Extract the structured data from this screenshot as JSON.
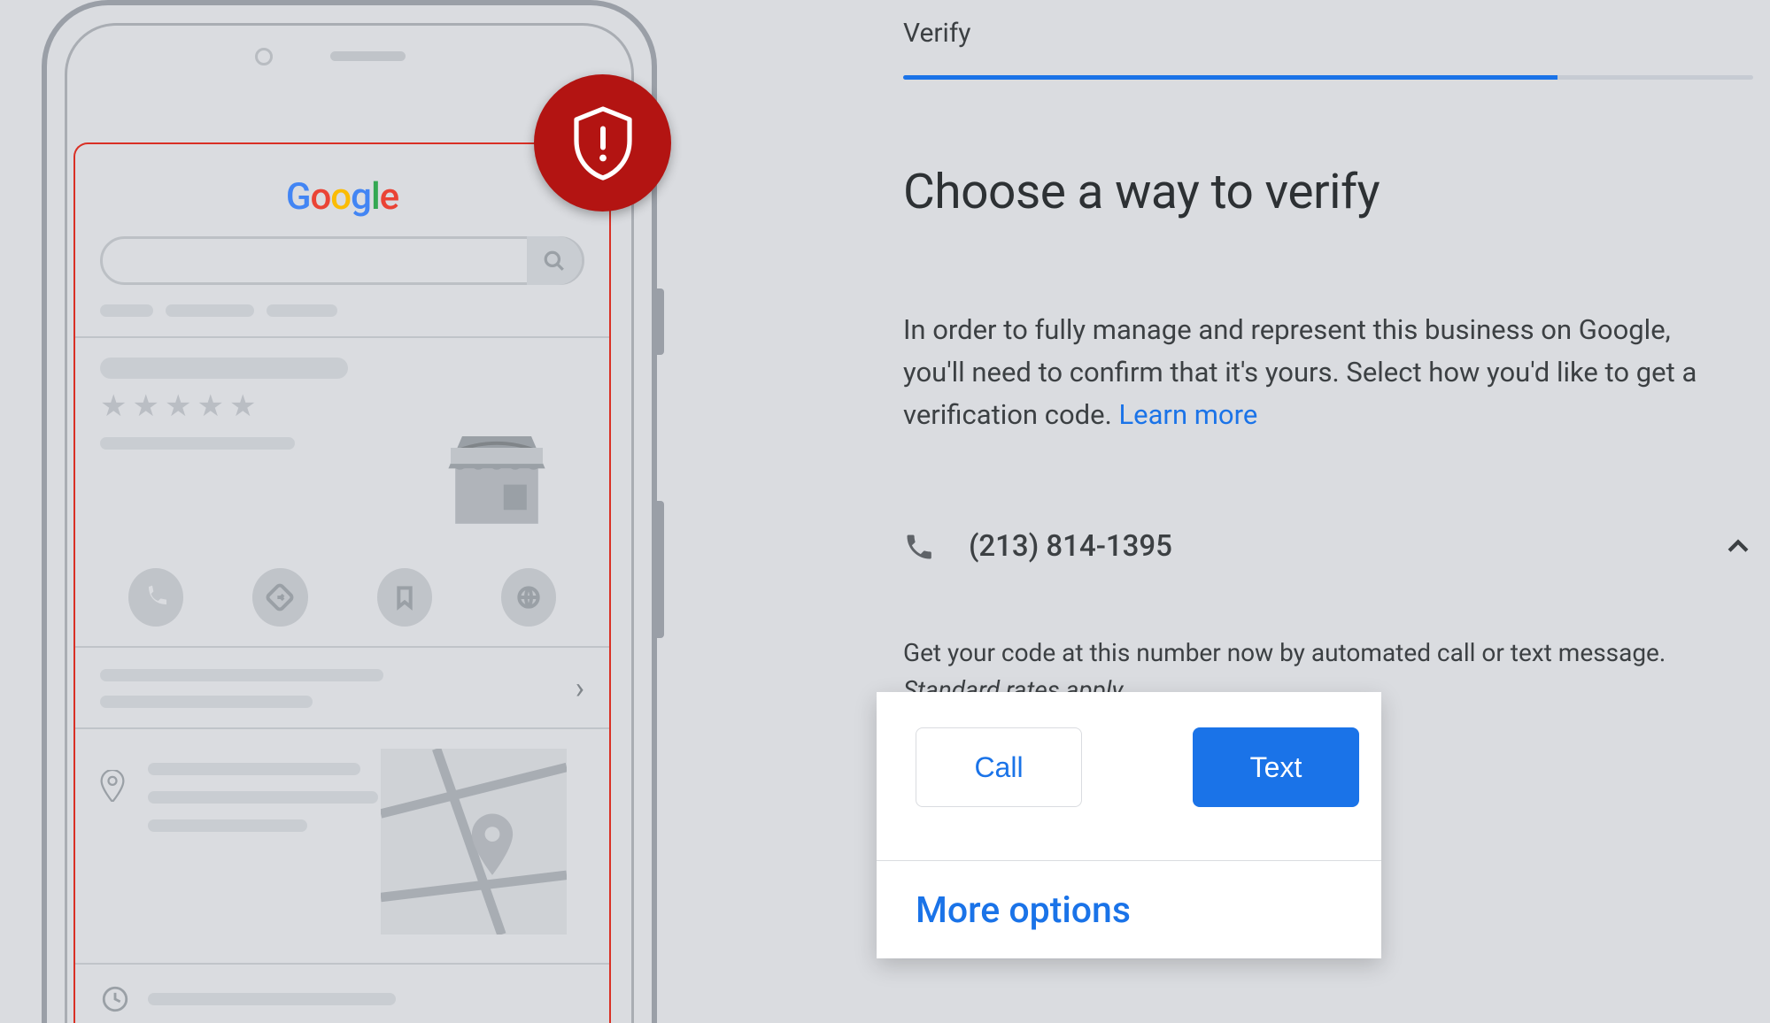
{
  "progress": {
    "step_label": "Verify",
    "percent": 77
  },
  "title": "Choose a way to verify",
  "description": "In order to fully manage and represent this business on Google, you'll need to confirm that it's yours. Select how you'd like to get a verification code. ",
  "learn_more": "Learn more",
  "phone": {
    "number": "(213) 814-1395"
  },
  "helper": {
    "line": "Get your code at this number now by automated call or text message.",
    "note": "Standard rates apply."
  },
  "buttons": {
    "call": "Call",
    "text": "Text"
  },
  "more_options": "More options",
  "illustration": {
    "logo_text": "Google"
  }
}
